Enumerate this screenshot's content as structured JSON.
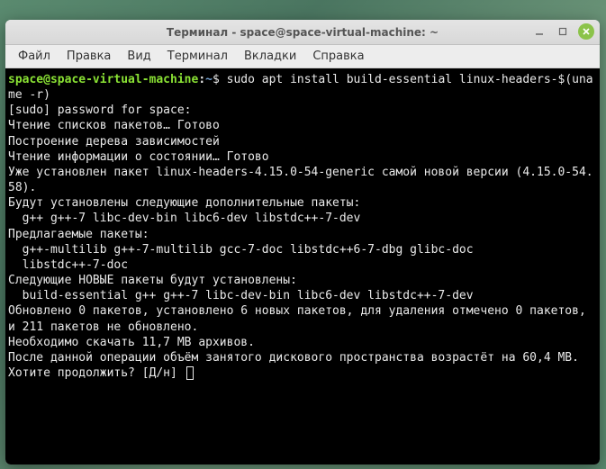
{
  "titlebar": {
    "title": "Терминал - space@space-virtual-machine: ~"
  },
  "menubar": {
    "items": [
      "Файл",
      "Правка",
      "Вид",
      "Терминал",
      "Вкладки",
      "Справка"
    ]
  },
  "prompt": {
    "user_host": "space@space-virtual-machine",
    "colon": ":",
    "path": "~",
    "dollar": "$"
  },
  "terminal": {
    "command": "sudo apt install build-essential linux-headers-$(uname -r)",
    "lines": [
      "[sudo] password for space:",
      "Чтение списков пакетов… Готово",
      "Построение дерева зависимостей",
      "Чтение информации о состоянии… Готово",
      "Уже установлен пакет linux-headers-4.15.0-54-generic самой новой версии (4.15.0-54.58).",
      "Будут установлены следующие дополнительные пакеты:",
      "  g++ g++-7 libc-dev-bin libc6-dev libstdc++-7-dev",
      "Предлагаемые пакеты:",
      "  g++-multilib g++-7-multilib gcc-7-doc libstdc++6-7-dbg glibc-doc",
      "  libstdc++-7-doc",
      "Следующие НОВЫЕ пакеты будут установлены:",
      "  build-essential g++ g++-7 libc-dev-bin libc6-dev libstdc++-7-dev",
      "Обновлено 0 пакетов, установлено 6 новых пакетов, для удаления отмечено 0 пакетов, и 211 пакетов не обновлено.",
      "Необходимо скачать 11,7 MB архивов.",
      "После данной операции объём занятого дискового пространства возрастёт на 60,4 MB.",
      "Хотите продолжить? [Д/н] "
    ]
  }
}
